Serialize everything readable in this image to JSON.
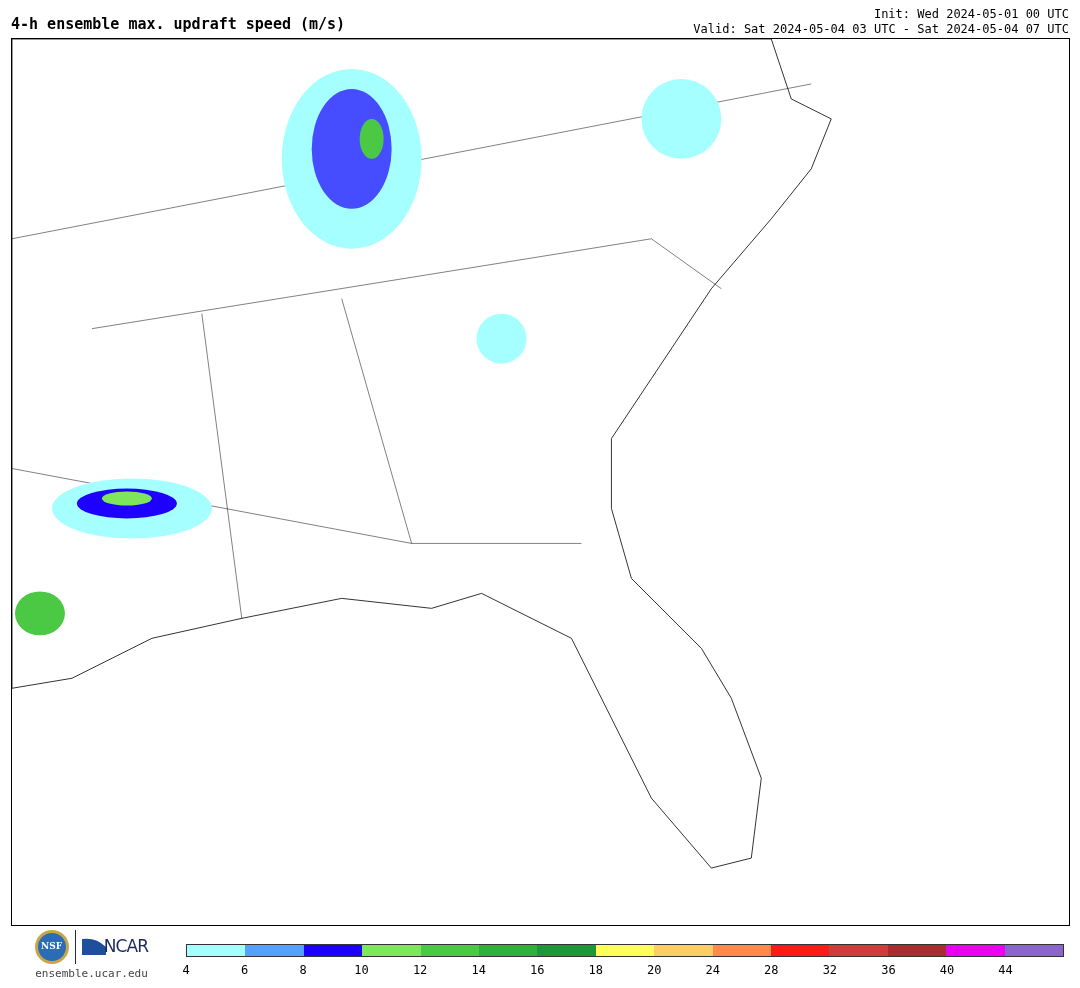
{
  "title": "4-h ensemble max. updraft speed (m/s)",
  "init": "Init: Wed 2024-05-01 00 UTC",
  "valid": "Valid: Sat 2024-05-04 03 UTC - Sat 2024-05-04 07 UTC",
  "logo": {
    "seal_text": "NSF",
    "wordmark": "NCAR",
    "site": "ensemble.ucar.edu"
  },
  "colorbar": {
    "segments": [
      {
        "color": "#a6ffff"
      },
      {
        "color": "#55a1ff"
      },
      {
        "color": "#1e00ff"
      },
      {
        "color": "#7ee65a"
      },
      {
        "color": "#4cc944"
      },
      {
        "color": "#2eb03a"
      },
      {
        "color": "#1f963a"
      },
      {
        "color": "#ffff5a"
      },
      {
        "color": "#ffcc66"
      },
      {
        "color": "#ff8a4c"
      },
      {
        "color": "#ff1a1a"
      },
      {
        "color": "#cc3d3d"
      },
      {
        "color": "#a62e2e"
      },
      {
        "color": "#ee00ee"
      },
      {
        "color": "#8a66cc"
      }
    ],
    "ticks": [
      "4",
      "6",
      "8",
      "10",
      "12",
      "14",
      "16",
      "18",
      "20",
      "24",
      "28",
      "32",
      "36",
      "40",
      "44"
    ]
  }
}
